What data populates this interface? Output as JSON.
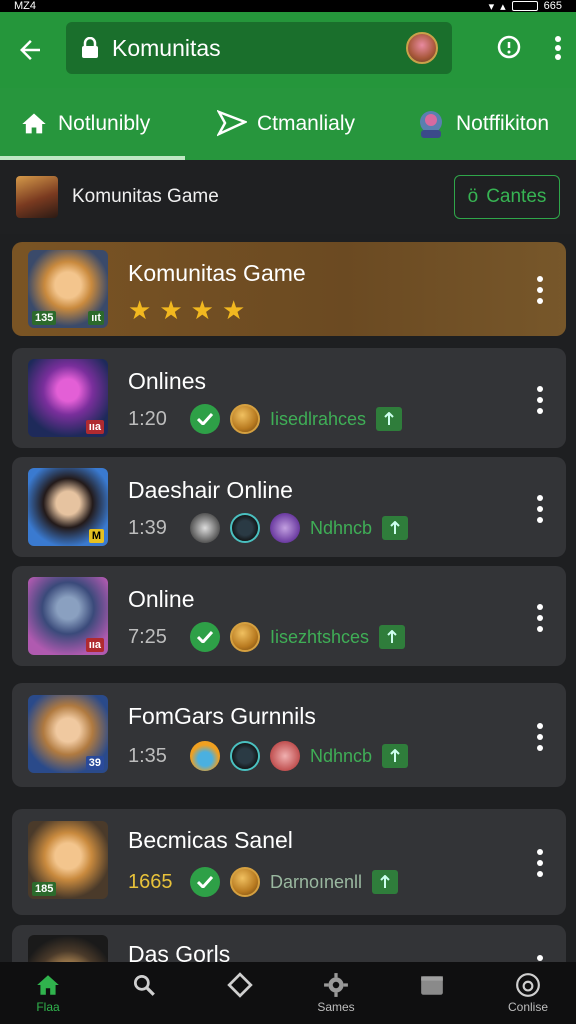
{
  "status_bar": {
    "time": "MZ4",
    "battery": "665"
  },
  "app_bar": {
    "title": "Komunitas"
  },
  "tabs": [
    {
      "label": "Notlunibly"
    },
    {
      "label": "Ctmanlialy"
    },
    {
      "label": "Notffikiton"
    }
  ],
  "community": {
    "title": "Komunitas Game",
    "button_label": "Cantes",
    "button_prefix": "ö"
  },
  "items": [
    {
      "name": "Komunitas Game",
      "rating": 4,
      "badge_left": "135",
      "badge_right": "ııt"
    },
    {
      "name": "Onlines",
      "time": "1:20",
      "status": "Iisedlrahces",
      "badge_right": "ııa"
    },
    {
      "name": "Daeshair Online",
      "time": "1:39",
      "status": "Ndhncb",
      "badge_right": "M"
    },
    {
      "name": "Online",
      "time": "7:25",
      "status": "Iisezhtshces",
      "badge_right": "ııa"
    },
    {
      "name": "FomGars Gurnnils",
      "time": "1:35",
      "status": "Ndhncb",
      "badge_right": "39"
    },
    {
      "name": "Becmicas Sanel",
      "time": "1665",
      "status": "Darnoınenll",
      "badge_left": "185"
    },
    {
      "name": "Das Gorls"
    }
  ],
  "bottom_nav": [
    {
      "label": "Flaa",
      "icon": "home-icon"
    },
    {
      "label": "",
      "icon": "search-icon"
    },
    {
      "label": "",
      "icon": "diamond-icon"
    },
    {
      "label": "Sames",
      "icon": "gear-icon"
    },
    {
      "label": "",
      "icon": "folder-icon"
    },
    {
      "label": "Conlise",
      "icon": "profile-icon"
    }
  ],
  "colors": {
    "primary": "#25963b",
    "primary_dark": "#1a6f2c",
    "card": "#333437",
    "featured": "#7a5424",
    "star": "#f2b81f"
  }
}
